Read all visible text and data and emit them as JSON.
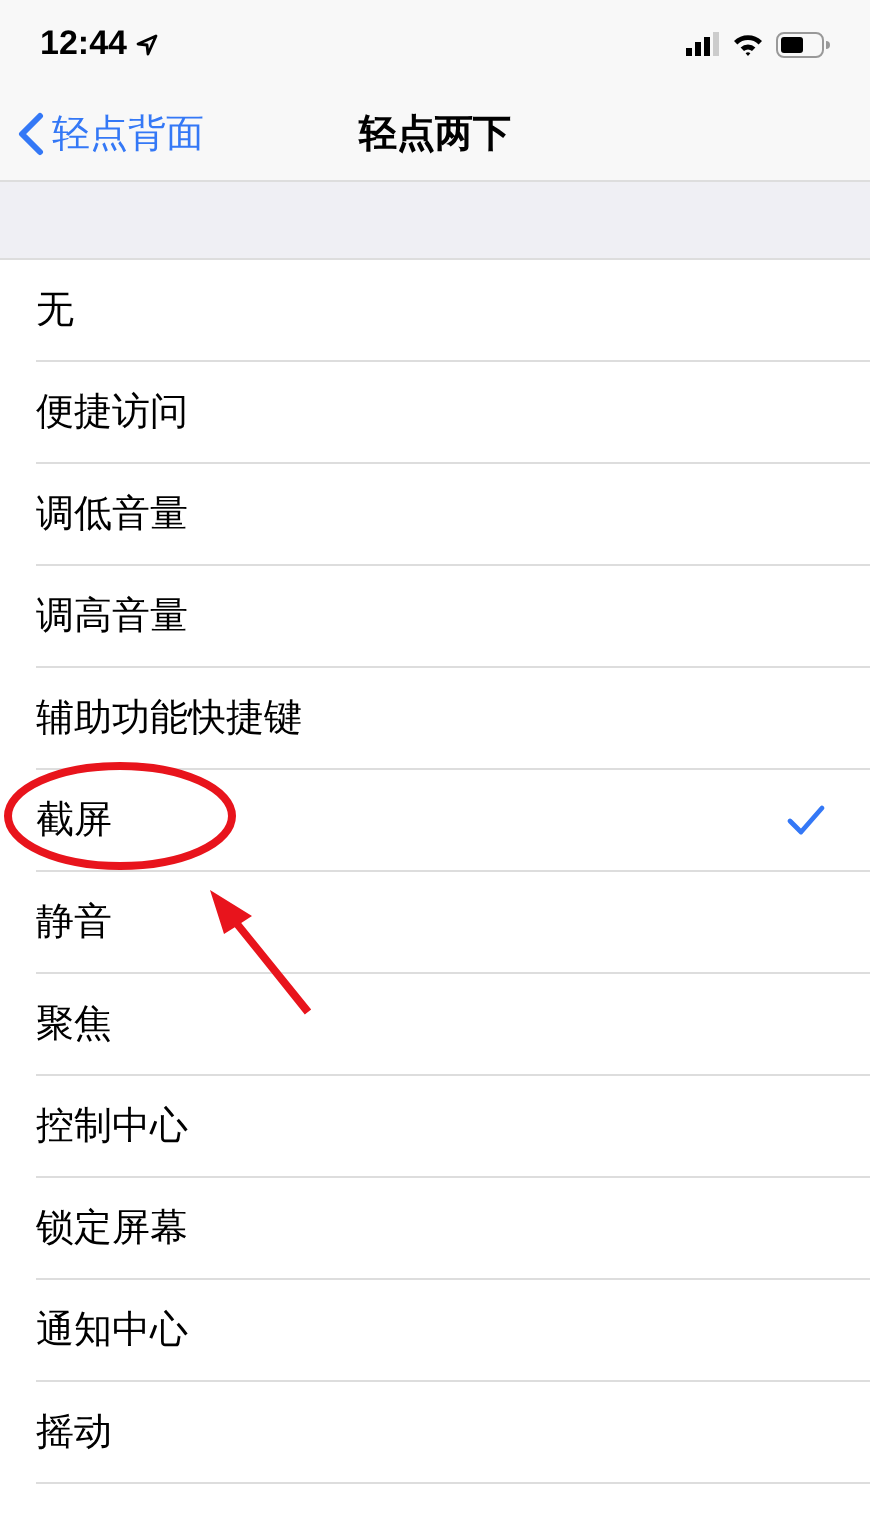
{
  "status_bar": {
    "time": "12:44"
  },
  "nav_bar": {
    "back": "轻点背面",
    "title": "轻点两下"
  },
  "options": [
    {
      "label": "无",
      "selected": false,
      "circled": false
    },
    {
      "label": "便捷访问",
      "selected": false,
      "circled": false
    },
    {
      "label": "调低音量",
      "selected": false,
      "circled": false
    },
    {
      "label": "调高音量",
      "selected": false,
      "circled": false
    },
    {
      "label": "辅助功能快捷键",
      "selected": false,
      "circled": false
    },
    {
      "label": "截屏",
      "selected": true,
      "circled": true
    },
    {
      "label": "静音",
      "selected": false,
      "circled": false
    },
    {
      "label": "聚焦",
      "selected": false,
      "circled": false
    },
    {
      "label": "控制中心",
      "selected": false,
      "circled": false
    },
    {
      "label": "锁定屏幕",
      "selected": false,
      "circled": false
    },
    {
      "label": "通知中心",
      "selected": false,
      "circled": false
    },
    {
      "label": "摇动",
      "selected": false,
      "circled": false
    }
  ]
}
